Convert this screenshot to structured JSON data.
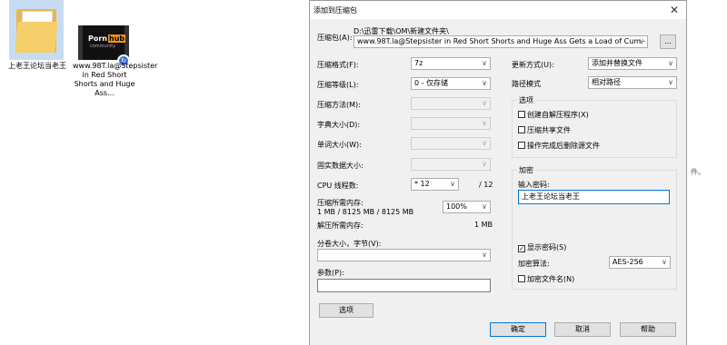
{
  "desktop": {
    "folder_label": "上老王论坛当老王",
    "video_label": "www.98T.la@Stepsister in Red Short Shorts and Huge Ass...",
    "video_logo": {
      "porn": "Porn",
      "hub": "hub",
      "community": "community"
    }
  },
  "edge_text": "件。",
  "dialog": {
    "title": "添加到压缩包",
    "archive_label": "压缩包(A):",
    "archive_path": "D:\\迅雷下载\\OM\\新建文件夹\\",
    "archive_name": "www.98T.la@Stepsister in Red Short Shorts and Huge Ass Gets a Load of Cum - Anny Walker - Po",
    "browse_label": "...",
    "format_label": "压缩格式(F):",
    "format_value": "7z",
    "level_label": "压缩等级(L):",
    "level_value": "0 - 仅存储",
    "method_label": "压缩方法(M):",
    "dict_label": "字典大小(D):",
    "word_label": "单词大小(W):",
    "solid_label": "固实数据大小:",
    "threads_label": "CPU 线程数:",
    "threads_value": "* 12",
    "threads_total": "/ 12",
    "mem_comp_label": "压缩所需内存:",
    "mem_comp_value": "1 MB / 8125 MB / 8125 MB",
    "mem_percent": "100%",
    "mem_decomp_label": "解压所需内存:",
    "mem_decomp_value": "1 MB",
    "split_label": "分卷大小，字节(V):",
    "params_label": "参数(P):",
    "options_button": "选项",
    "update_label": "更新方式(U):",
    "update_value": "添加并替换文件",
    "path_label": "路径模式",
    "path_value": "相对路径",
    "options_group": "选项",
    "opt_sfx": "创建自解压程序(X)",
    "opt_shared": "压缩共享文件",
    "opt_delete": "操作完成后删除源文件",
    "enc_group": "加密",
    "password_label": "输入密码:",
    "password_value": "上老王论坛当老王",
    "show_password": "显示密码(S)",
    "enc_method_label": "加密算法:",
    "enc_method_value": "AES-256",
    "enc_names": "加密文件名(N)",
    "ok": "确定",
    "cancel": "取消",
    "help": "帮助"
  }
}
